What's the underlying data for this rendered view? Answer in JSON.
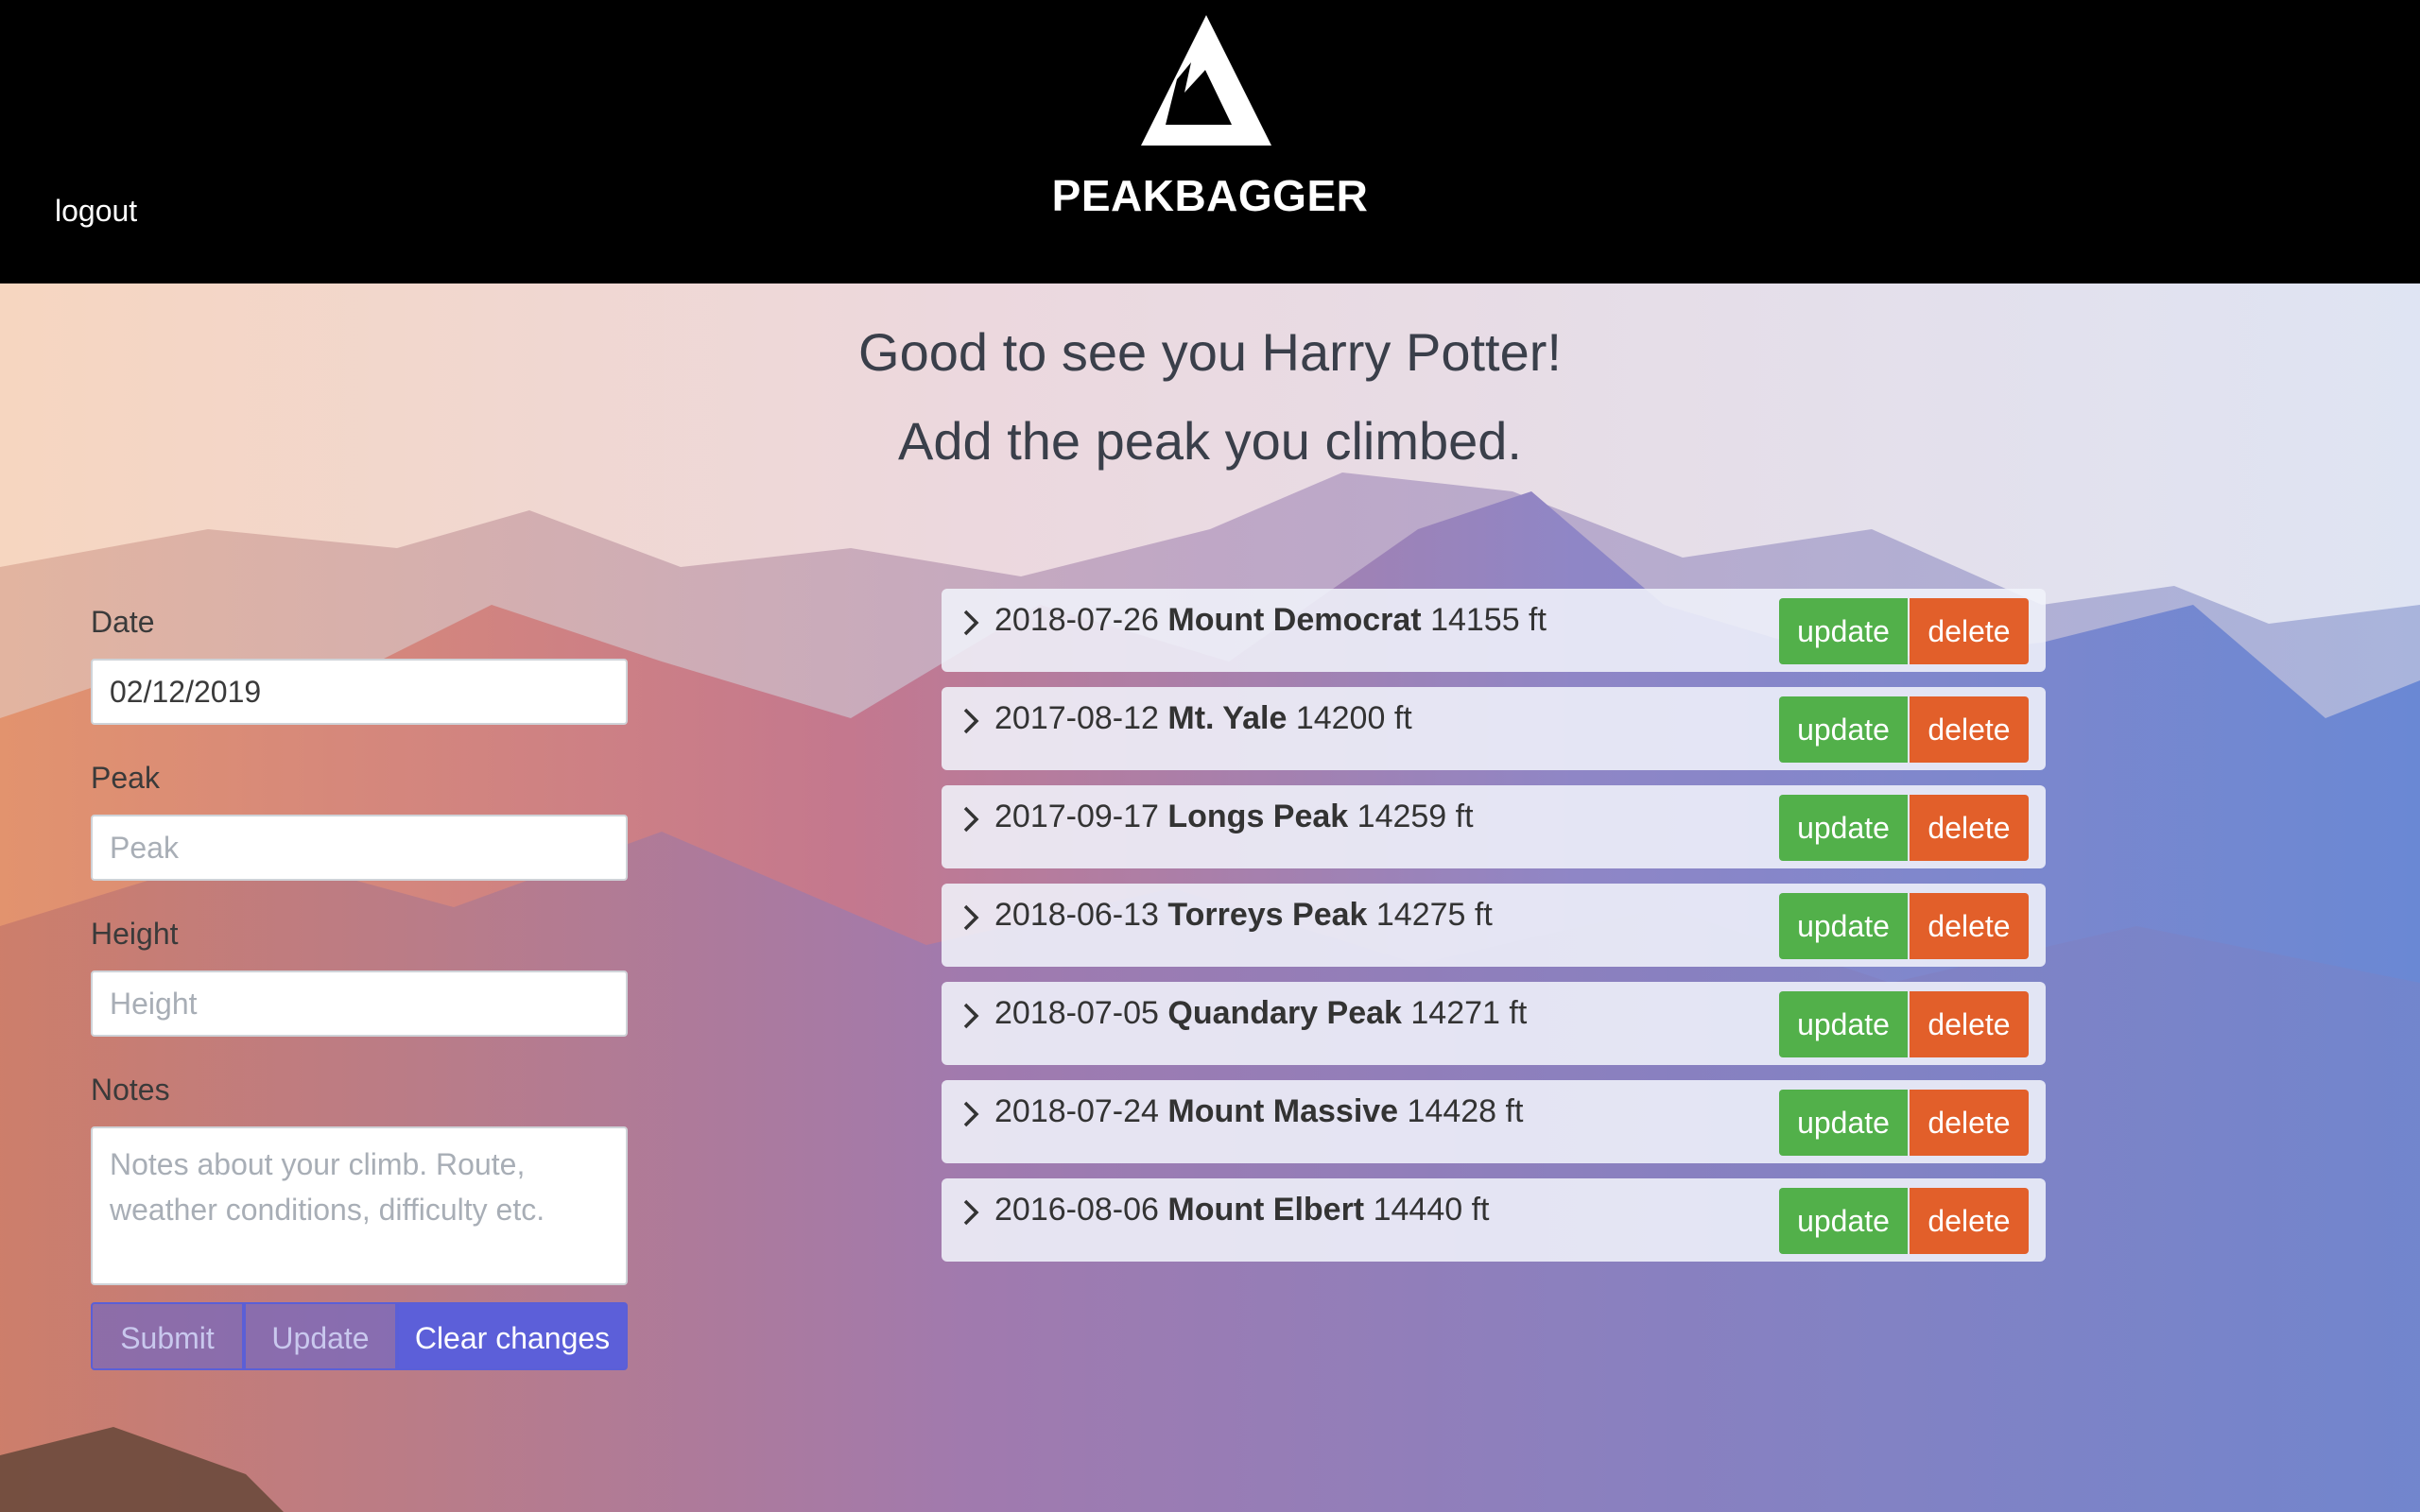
{
  "header": {
    "brand": "PEAKBAGGER",
    "logout_label": "logout",
    "logo_icon": "mountain-icon"
  },
  "greeting": {
    "line1": "Good to see you Harry Potter!",
    "line2": "Add the peak you climbed."
  },
  "form": {
    "date_label": "Date",
    "date_value": "02/12/2019",
    "peak_label": "Peak",
    "peak_placeholder": "Peak",
    "height_label": "Height",
    "height_placeholder": "Height",
    "notes_label": "Notes",
    "notes_placeholder": "Notes about your climb. Route, weather conditions, difficulty etc.",
    "submit_label": "Submit",
    "update_label": "Update",
    "clear_label": "Clear changes"
  },
  "climbs": [
    {
      "date": "2018-07-26",
      "peak": "Mount Democrat",
      "height": "14155 ft"
    },
    {
      "date": "2017-08-12",
      "peak": "Mt. Yale",
      "height": "14200 ft"
    },
    {
      "date": "2017-09-17",
      "peak": "Longs Peak",
      "height": "14259 ft"
    },
    {
      "date": "2018-06-13",
      "peak": "Torreys Peak",
      "height": "14275 ft"
    },
    {
      "date": "2018-07-05",
      "peak": "Quandary Peak",
      "height": "14271 ft"
    },
    {
      "date": "2018-07-24",
      "peak": "Mount Massive",
      "height": "14428 ft"
    },
    {
      "date": "2016-08-06",
      "peak": "Mount Elbert",
      "height": "14440 ft"
    }
  ],
  "row_actions": {
    "update_label": "update",
    "delete_label": "delete"
  },
  "colors": {
    "update": "#52b04a",
    "delete": "#e25f2a",
    "primary": "#5c5fd9"
  }
}
